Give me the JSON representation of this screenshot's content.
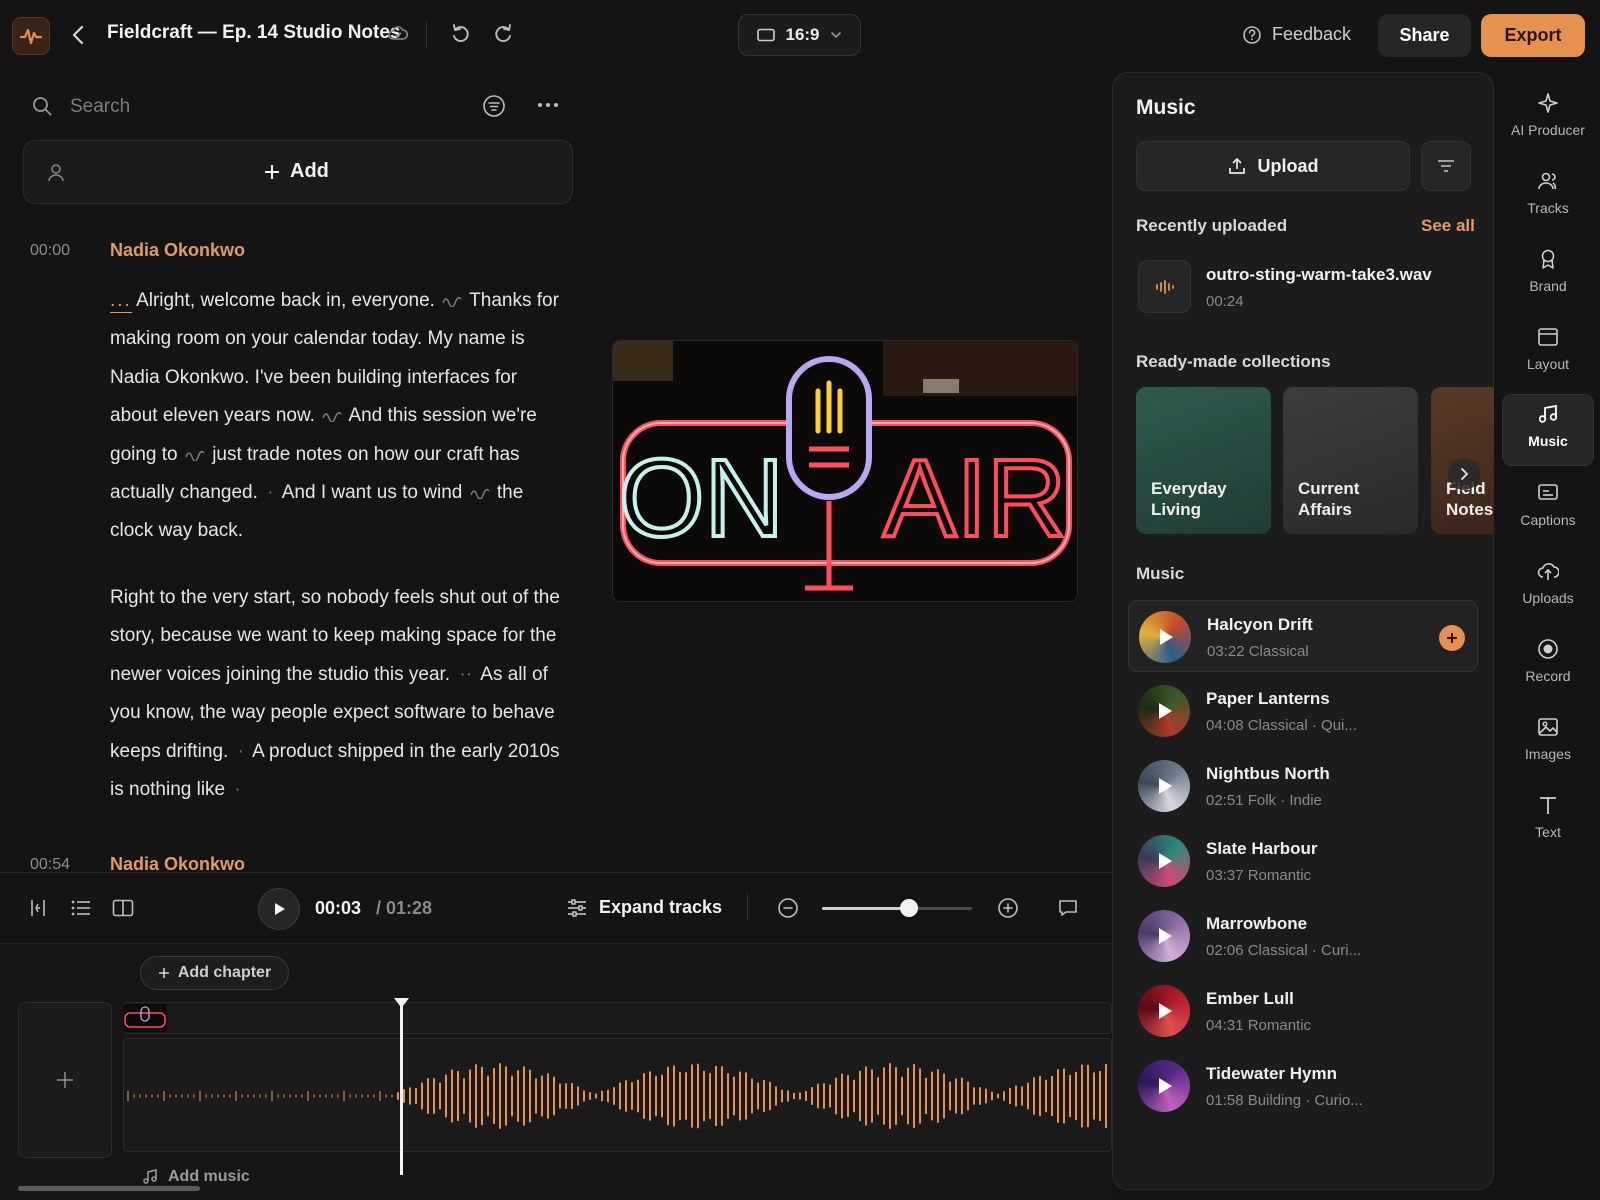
{
  "header": {
    "project_title": "Fieldcraft — Ep. 14 Studio Notes",
    "aspect_ratio": "16:9",
    "feedback_label": "Feedback",
    "share_label": "Share",
    "export_label": "Export"
  },
  "transcript": {
    "search_placeholder": "Search",
    "add_label": "Add",
    "blocks": [
      {
        "timestamp": "00:00",
        "speaker": "Nadia Okonkwo",
        "p1": {
          "ellipsis": "...",
          "s1": "Alright, welcome back in, everyone.",
          "s2": "Thanks for making room on your calendar today. My name is Nadia Okonkwo. I've been building interfaces for about eleven years now.",
          "s3": "And this session we're going to",
          "s4": "just trade notes on how our craft has actually changed.",
          "s5": "And I want us to wind",
          "s6": "the clock way back."
        },
        "p2": {
          "s1": "Right to the very start, so nobody feels shut out of the story, because we want to keep making space for the newer voices joining the studio this year.",
          "s2": "As all of you know, the way people expect software to behave keeps drifting.",
          "s3": "A product shipped in the early 2010s is nothing like"
        }
      },
      {
        "timestamp": "00:54",
        "speaker": "Nadia Okonkwo"
      }
    ]
  },
  "preview": {
    "sign_left": "ON",
    "sign_right": "AIR"
  },
  "playback": {
    "current_time": "00:03",
    "total_time": "/ 01:28",
    "expand_tracks_label": "Expand tracks",
    "zoom_level": 0.6
  },
  "timeline": {
    "add_chapter_label": "Add chapter",
    "add_music_label": "Add music"
  },
  "music_panel": {
    "title": "Music",
    "upload_label": "Upload",
    "recently_uploaded_label": "Recently uploaded",
    "see_all_label": "See all",
    "recent_file": {
      "name": "outro-sting-warm-take3.wav",
      "duration": "00:24"
    },
    "collections_label": "Ready-made collections",
    "collections": [
      {
        "line1": "Everyday",
        "line2": "Living"
      },
      {
        "line1": "Current",
        "line2": "Affairs"
      },
      {
        "line1": "Field",
        "line2": "Notes"
      }
    ],
    "music_label": "Music",
    "tracks": [
      {
        "title": "Halcyon Drift",
        "meta": "03:22 Classical",
        "thumb": [
          "#c44a2a",
          "#2b5d8c",
          "#e0b040"
        ]
      },
      {
        "title": "Paper Lanterns",
        "meta": "04:08 Classical · Qui...",
        "thumb": [
          "#3a5a2a",
          "#b03a2a",
          "#1c2a14"
        ]
      },
      {
        "title": "Nightbus North",
        "meta": "02:51 Folk · Indie",
        "thumb": [
          "#6a7a8a",
          "#d8d8e0",
          "#3a4a5a"
        ]
      },
      {
        "title": "Slate Harbour",
        "meta": "03:37 Romantic",
        "thumb": [
          "#2a8a7a",
          "#d04a7a",
          "#3a3a5a"
        ]
      },
      {
        "title": "Marrowbone",
        "meta": "02:06 Classical · Curi...",
        "thumb": [
          "#8a6aa0",
          "#d0b0d8",
          "#4a3a6a"
        ]
      },
      {
        "title": "Ember Lull",
        "meta": "04:31 Romantic",
        "thumb": [
          "#b01a2a",
          "#e05050",
          "#5a0a14"
        ]
      },
      {
        "title": "Tidewater Hymn",
        "meta": "01:58 Building · Curio...",
        "thumb": [
          "#5a2a8a",
          "#c060c0",
          "#2a1a5a"
        ]
      }
    ]
  },
  "rail": {
    "items": [
      {
        "label": "AI Producer",
        "icon": "sparkle-icon"
      },
      {
        "label": "Tracks",
        "icon": "people-icon"
      },
      {
        "label": "Brand",
        "icon": "award-icon"
      },
      {
        "label": "Layout",
        "icon": "layout-icon"
      },
      {
        "label": "Music",
        "icon": "music-note-icon"
      },
      {
        "label": "Captions",
        "icon": "captions-icon"
      },
      {
        "label": "Uploads",
        "icon": "cloud-upload-icon"
      },
      {
        "label": "Record",
        "icon": "record-icon"
      },
      {
        "label": "Images",
        "icon": "image-icon"
      },
      {
        "label": "Text",
        "icon": "text-icon"
      }
    ]
  },
  "colors": {
    "accent": "#e5914f",
    "speaker": "#e49a66",
    "background": "#141414",
    "panel": "#1c1c1c"
  }
}
